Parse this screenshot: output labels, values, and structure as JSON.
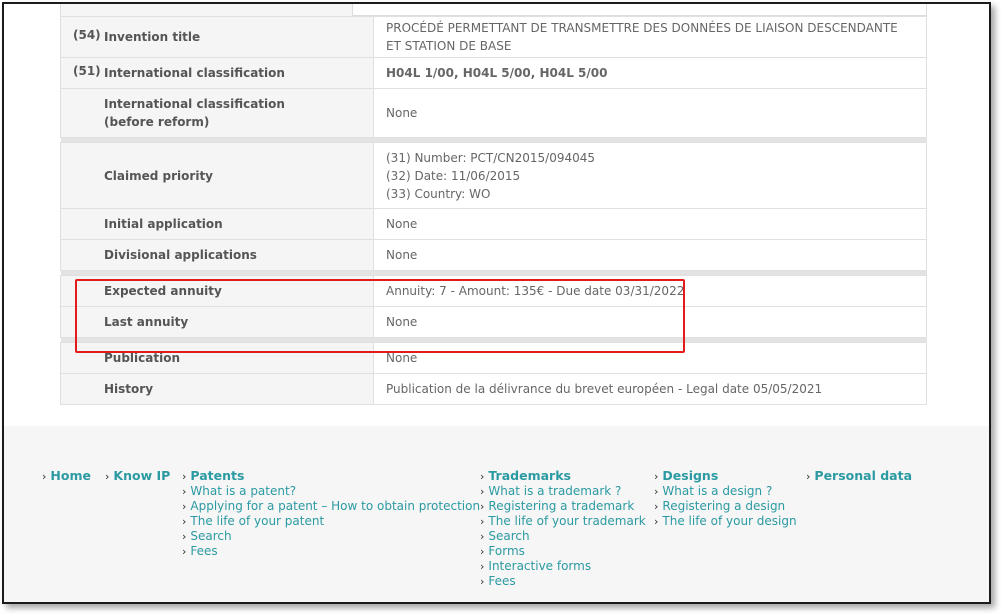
{
  "rows": {
    "invention_title": {
      "num": "(54)",
      "label": "Invention title",
      "value": "PROCÉDÉ PERMETTANT DE TRANSMETTRE DES DONNÉES DE LIAISON DESCENDANTE ET STATION DE BASE"
    },
    "intl_class": {
      "num": "(51)",
      "label": "International classification",
      "value": "H04L 1/00, H04L 5/00, H04L 5/00"
    },
    "intl_class_before": {
      "label": "International classification (before reform)",
      "value": "None"
    },
    "claimed_priority": {
      "label": "Claimed priority",
      "line1": "(31) Number: PCT/CN2015/094045",
      "line2": "(32) Date: 11/06/2015",
      "line3": "(33) Country: WO"
    },
    "initial_application": {
      "label": "Initial application",
      "value": "None"
    },
    "divisional_applications": {
      "label": "Divisional applications",
      "value": "None"
    },
    "expected_annuity": {
      "label": "Expected annuity",
      "value": "Annuity: 7 - Amount: 135€ - Due date 03/31/2022"
    },
    "last_annuity": {
      "label": "Last annuity",
      "value": "None"
    },
    "publication": {
      "label": "Publication",
      "value": "None"
    },
    "history": {
      "label": "History",
      "value": "Publication de la délivrance du brevet européen - Legal date 05/05/2021"
    }
  },
  "footer": {
    "home": "Home",
    "know_ip": "Know IP",
    "patents": {
      "title": "Patents",
      "items": [
        "What is a patent?",
        "Applying for a patent – How to obtain protection",
        "The life of your patent",
        "Search",
        "Fees"
      ]
    },
    "trademarks": {
      "title": "Trademarks",
      "items": [
        "What is a trademark ?",
        "Registering a trademark",
        "The life of your trademark",
        "Search",
        "Forms",
        "Interactive forms",
        "Fees"
      ]
    },
    "designs": {
      "title": "Designs",
      "items": [
        "What is a design ?",
        "Registering a design",
        "The life of your design"
      ]
    },
    "personal_data": "Personal data"
  },
  "colors": {
    "link": "#2c9aa3",
    "highlight_border": "#e31b1b",
    "label_bg": "#f5f5f5"
  },
  "icons": {
    "chevron": "chevron-right-icon"
  }
}
